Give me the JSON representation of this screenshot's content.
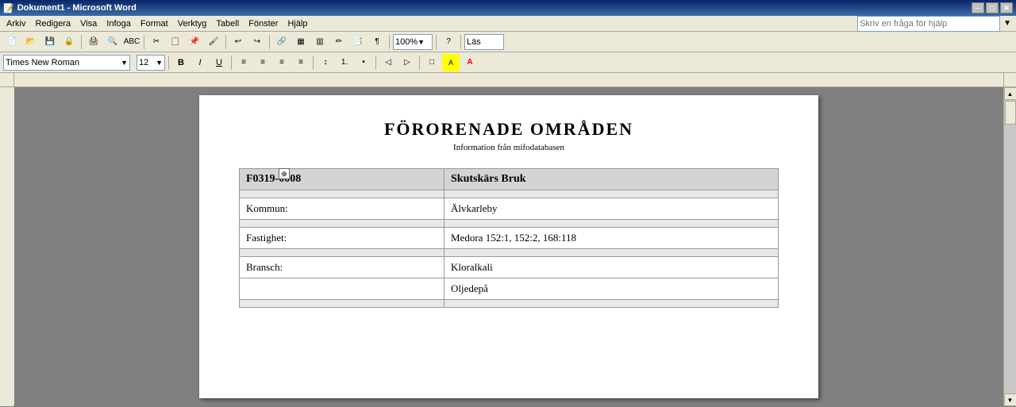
{
  "titlebar": {
    "title": "Dokument1 - Microsoft Word",
    "minimize": "─",
    "restore": "□",
    "close": "✕"
  },
  "menubar": {
    "items": [
      "Arkiv",
      "Redigera",
      "Visa",
      "Infoga",
      "Format",
      "Verktyg",
      "Tabell",
      "Fönster",
      "Hjälp"
    ]
  },
  "toolbar": {
    "help_placeholder": "Skriv en fråga för hjälp",
    "zoom": "100%",
    "view_label": "Läs"
  },
  "toolbar2": {
    "font_name": "Times New Roman",
    "font_size": "12"
  },
  "document": {
    "title": "FÖRORENADE OMRÅDEN",
    "subtitle": "Information från mifodatabasen",
    "table": {
      "header": {
        "col1": "F0319-0008",
        "col2": "Skutskärs Bruk"
      },
      "rows": [
        {
          "label": "",
          "value": ""
        },
        {
          "label": "Kommun:",
          "value": "Älvkarleby"
        },
        {
          "label": "",
          "value": ""
        },
        {
          "label": "Fastighet:",
          "value": "Medora 152:1, 152:2, 168:118"
        },
        {
          "label": "",
          "value": ""
        },
        {
          "label": "Bransch:",
          "value": "Kloralkali"
        },
        {
          "label": "",
          "value": "Oljedepå"
        },
        {
          "label": "",
          "value": ""
        }
      ]
    }
  }
}
